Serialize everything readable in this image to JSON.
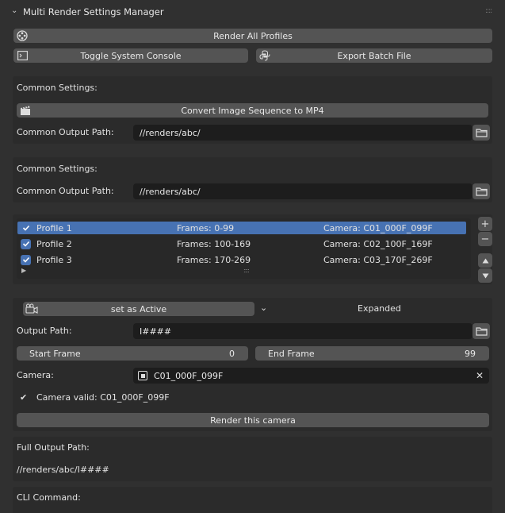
{
  "header": {
    "title": "Multi Render Settings Manager"
  },
  "toolbar": {
    "render_all": "Render All Profiles",
    "toggle_console": "Toggle System Console",
    "export_batch": "Export Batch File"
  },
  "common1": {
    "heading": "Common Settings:",
    "convert_btn": "Convert Image Sequence to MP4",
    "output_label": "Common Output Path:",
    "output_value": "//renders/abc/"
  },
  "common2": {
    "heading": "Common Settings:",
    "output_label": "Common Output Path:",
    "output_value": "//renders/abc/"
  },
  "profiles": [
    {
      "name": "Profile 1",
      "frames": "Frames: 0-99",
      "camera": "Camera: C01_000F_099F",
      "selected": true
    },
    {
      "name": "Profile 2",
      "frames": "Frames: 100-169",
      "camera": "Camera: C02_100F_169F",
      "selected": false
    },
    {
      "name": "Profile 3",
      "frames": "Frames: 170-269",
      "camera": "Camera: C03_170F_269F",
      "selected": false
    }
  ],
  "active": {
    "set_active": "set as Active",
    "expanded": "Expanded",
    "output_label": "Output Path:",
    "output_value": "I####",
    "start_label": "Start Frame",
    "start_value": "0",
    "end_label": "End Frame",
    "end_value": "99",
    "camera_label": "Camera:",
    "camera_value": "C01_000F_099F",
    "camera_valid": "Camera valid: C01_000F_099F",
    "render_camera": "Render this camera"
  },
  "full_output": {
    "label": "Full Output Path:",
    "value": "//renders/abc/I####"
  },
  "cli": {
    "label": "CLI Command:"
  },
  "colors": {
    "accent": "#4772b3",
    "panel": "#2b2b2b",
    "background": "#303030"
  }
}
